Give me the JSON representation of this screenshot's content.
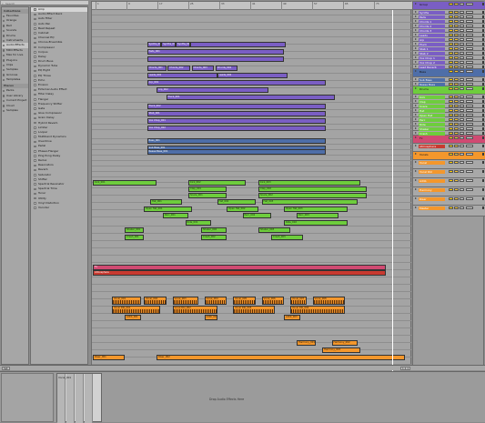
{
  "browser": {
    "search_placeholder": "Search",
    "collections_header": "Collections",
    "categories": [
      "Favorites",
      "Orange",
      "Red",
      "Sounds",
      "Drums",
      "Instruments",
      "Audio Effects",
      "MIDI Effects",
      "Max for Live",
      "Plug-Ins",
      "Clips",
      "Samples",
      "Grooves",
      "Templates"
    ],
    "selected_category": "Audio Effects",
    "places_header": "Places",
    "places": [
      "Packs",
      "User Library",
      "Current Project",
      "Cloud",
      "Samples"
    ],
    "items": [
      "Amp",
      "Audio Effect Rack",
      "Auto Filter",
      "Auto Pan",
      "Beat Repeat",
      "Cabinet",
      "Channel EQ",
      "Chorus-Ensemble",
      "Compressor",
      "Corpus",
      "Delay",
      "Drum Buss",
      "Dynamic Tube",
      "EQ Eight",
      "EQ Three",
      "Echo",
      "Erosion",
      "External Audio Effect",
      "Filter Delay",
      "Flanger",
      "Frequency Shifter",
      "Gate",
      "Glue Compressor",
      "Grain Delay",
      "Hybrid Reverb",
      "Limiter",
      "Looper",
      "Multiband Dynamics",
      "Overdrive",
      "Pedal",
      "Phaser-Flanger",
      "Ping Pong Delay",
      "Redux",
      "Resonators",
      "Reverb",
      "Saturator",
      "Shifter",
      "Spectral Resonator",
      "Spectral Time",
      "Tuner",
      "Utility",
      "Vinyl Distortion",
      "Vocoder"
    ],
    "selected_item": "Amp"
  },
  "arrangement": {
    "ruler_labels": [
      "1",
      "9",
      "17",
      "25",
      "33",
      "41",
      "49",
      "57",
      "65",
      "73"
    ],
    "clips": [
      {
        "row": 0,
        "start": 0.17,
        "len": 0.045,
        "color": "purple",
        "label": "Synths_001"
      },
      {
        "row": 0,
        "start": 0.215,
        "len": 0.045,
        "color": "purple",
        "label": "Synths_002"
      },
      {
        "row": 0,
        "start": 0.26,
        "len": 0.045,
        "color": "purple",
        "label": "Synths_003"
      },
      {
        "row": 0,
        "start": 0.305,
        "len": 0.3,
        "color": "purple",
        "label": ""
      },
      {
        "row": 1,
        "start": 0.17,
        "len": 0.43,
        "color": "purple",
        "label": "Pads_001"
      },
      {
        "row": 2,
        "start": 0.17,
        "len": 0.43,
        "color": "purple",
        "label": ""
      },
      {
        "row": 3,
        "start": 0.17,
        "len": 0.06,
        "color": "purple",
        "label": "Chords_001"
      },
      {
        "row": 3,
        "start": 0.235,
        "len": 0.07,
        "color": "purple",
        "label": "Chords_002"
      },
      {
        "row": 3,
        "start": 0.31,
        "len": 0.07,
        "color": "purple",
        "label": "Chords_003"
      },
      {
        "row": 3,
        "start": 0.385,
        "len": 0.07,
        "color": "purple",
        "label": "Chords_004"
      },
      {
        "row": 4,
        "start": 0.17,
        "len": 0.22,
        "color": "purple",
        "label": "Leads_001"
      },
      {
        "row": 4,
        "start": 0.39,
        "len": 0.22,
        "color": "purple",
        "label": "Leads_002"
      },
      {
        "row": 5,
        "start": 0.17,
        "len": 0.56,
        "color": "purple",
        "label": "Arp_001"
      },
      {
        "row": 6,
        "start": 0.2,
        "len": 0.35,
        "color": "purple",
        "label": "Arp_002"
      },
      {
        "row": 7,
        "start": 0.23,
        "len": 0.53,
        "color": "purple",
        "label": "Pluck_001"
      },
      {
        "row": 8,
        "start": 0.17,
        "len": 0.56,
        "color": "purple",
        "label": "Pluck_002"
      },
      {
        "row": 9,
        "start": 0.17,
        "len": 0.56,
        "color": "purple",
        "label": "Stab_001"
      },
      {
        "row": 10,
        "start": 0.17,
        "len": 0.56,
        "color": "purple",
        "label": "Vox Chop_001"
      },
      {
        "row": 11,
        "start": 0.17,
        "len": 0.56,
        "color": "purple",
        "label": "Vox Chop_002"
      },
      {
        "row": 12,
        "start": 0.17,
        "len": 0.56,
        "color": "blue",
        "label": "Bass_001"
      },
      {
        "row": 13,
        "start": 0.17,
        "len": 0.56,
        "color": "blue",
        "label": "Sub Bass_001"
      },
      {
        "row": 14,
        "start": 0.17,
        "len": 0.56,
        "color": "blue",
        "label": "Reese Bass_001"
      },
      {
        "row": 15,
        "start": 0,
        "len": 0.2,
        "color": "green",
        "label": "Kick_001"
      },
      {
        "row": 15,
        "start": 0.3,
        "len": 0.18,
        "color": "green",
        "label": "Kick_002"
      },
      {
        "row": 15,
        "start": 0.52,
        "len": 0.32,
        "color": "green",
        "label": "Kick_003"
      },
      {
        "row": 16,
        "start": 0.3,
        "len": 0.12,
        "color": "green",
        "label": "Clap_001"
      },
      {
        "row": 16,
        "start": 0.52,
        "len": 0.34,
        "color": "green",
        "label": "Clap_002"
      },
      {
        "row": 17,
        "start": 0.3,
        "len": 0.12,
        "color": "green",
        "label": "Snare_001"
      },
      {
        "row": 17,
        "start": 0.52,
        "len": 0.34,
        "color": "green",
        "label": "Snare_002"
      },
      {
        "row": 18,
        "start": 0.18,
        "len": 0.1,
        "color": "green",
        "label": "Hat_001"
      },
      {
        "row": 18,
        "start": 0.39,
        "len": 0.12,
        "color": "green",
        "label": "Hat_002"
      },
      {
        "row": 18,
        "start": 0.53,
        "len": 0.3,
        "color": "green",
        "label": "Hat_003"
      },
      {
        "row": 19,
        "start": 0.16,
        "len": 0.15,
        "color": "green",
        "label": "Open Hat_001"
      },
      {
        "row": 19,
        "start": 0.42,
        "len": 0.1,
        "color": "green",
        "label": "Open Hat_002"
      },
      {
        "row": 19,
        "start": 0.6,
        "len": 0.2,
        "color": "green",
        "label": "Open Hat_003"
      },
      {
        "row": 20,
        "start": 0.22,
        "len": 0.08,
        "color": "green",
        "label": "Perc_001"
      },
      {
        "row": 20,
        "start": 0.47,
        "len": 0.09,
        "color": "green",
        "label": "Perc_002"
      },
      {
        "row": 20,
        "start": 0.64,
        "len": 0.13,
        "color": "green",
        "label": "Perc_003"
      },
      {
        "row": 21,
        "start": 0.29,
        "len": 0.08,
        "color": "green",
        "label": "Ride_001"
      },
      {
        "row": 21,
        "start": 0.6,
        "len": 0.2,
        "color": "green",
        "label": "Ride_002"
      },
      {
        "row": 22,
        "start": 0.1,
        "len": 0.06,
        "color": "green",
        "label": "Shaker_001"
      },
      {
        "row": 22,
        "start": 0.34,
        "len": 0.08,
        "color": "green",
        "label": "Shaker_002"
      },
      {
        "row": 22,
        "start": 0.52,
        "len": 0.1,
        "color": "green",
        "label": "Shaker_003"
      },
      {
        "row": 23,
        "start": 0.1,
        "len": 0.06,
        "color": "green",
        "label": "Crash_001"
      },
      {
        "row": 23,
        "start": 0.34,
        "len": 0.08,
        "color": "green",
        "label": "Crash_002"
      },
      {
        "row": 23,
        "start": 0.56,
        "len": 0.1,
        "color": "green",
        "label": "Crash_003"
      },
      {
        "row": 24,
        "start": 0,
        "len": 0.92,
        "color": "pink",
        "label": "Fx"
      },
      {
        "row": 25,
        "start": 0,
        "len": 0.92,
        "color": "red",
        "label": "Atmosphere"
      },
      {
        "row": 26,
        "start": 0.06,
        "len": 0.09,
        "color": "orange",
        "label": "Vocal_001"
      },
      {
        "row": 26,
        "start": 0.16,
        "len": 0.07,
        "color": "orange",
        "label": "Vocal_002"
      },
      {
        "row": 26,
        "start": 0.25,
        "len": 0.08,
        "color": "orange",
        "label": "Vocal_003"
      },
      {
        "row": 26,
        "start": 0.35,
        "len": 0.07,
        "color": "orange",
        "label": "Vocal_004"
      },
      {
        "row": 26,
        "start": 0.44,
        "len": 0.07,
        "color": "orange",
        "label": "Vocal_005"
      },
      {
        "row": 26,
        "start": 0.53,
        "len": 0.07,
        "color": "orange",
        "label": "Vocal_006"
      },
      {
        "row": 26,
        "start": 0.62,
        "len": 0.05,
        "color": "orange",
        "label": "Vocal_007"
      },
      {
        "row": 26,
        "start": 0.69,
        "len": 0.1,
        "color": "orange",
        "label": "Vocal_008"
      },
      {
        "row": 27,
        "start": 0.06,
        "len": 0.15,
        "color": "orange",
        "label": "Vocal Dbl_001"
      },
      {
        "row": 27,
        "start": 0.25,
        "len": 0.14,
        "color": "orange",
        "label": "Vocal Dbl_002"
      },
      {
        "row": 27,
        "start": 0.44,
        "len": 0.13,
        "color": "orange",
        "label": "Vocal Dbl_003"
      },
      {
        "row": 27,
        "start": 0.62,
        "len": 0.17,
        "color": "orange",
        "label": "Vocal Dbl_004"
      },
      {
        "row": 28,
        "start": 0.1,
        "len": 0.05,
        "color": "orange",
        "label": "Adlib_001"
      },
      {
        "row": 28,
        "start": 0.35,
        "len": 0.04,
        "color": "orange",
        "label": "Adlib_002"
      },
      {
        "row": 28,
        "start": 0.6,
        "len": 0.05,
        "color": "orange",
        "label": "Adlib_003"
      },
      {
        "row": 29,
        "start": 0.64,
        "len": 0.06,
        "color": "orange",
        "label": "Harmony_001"
      },
      {
        "row": 29,
        "start": 0.75,
        "len": 0.08,
        "color": "orange",
        "label": "Harmony_002"
      },
      {
        "row": 30,
        "start": 0.72,
        "len": 0.12,
        "color": "orange",
        "label": "Harmony_003"
      },
      {
        "row": 31,
        "start": 0,
        "len": 0.1,
        "color": "orange",
        "label": "Riser_001"
      },
      {
        "row": 31,
        "start": 0.2,
        "len": 0.78,
        "color": "orange",
        "label": "Riser_002"
      }
    ]
  },
  "mixer": {
    "tracks": [
      {
        "name": "Group",
        "color": "#7a5ec4",
        "group": true
      },
      {
        "name": "Synths",
        "color": "#7a5ec4"
      },
      {
        "name": "Pads",
        "color": "#7a5ec4"
      },
      {
        "name": "Chords 1",
        "color": "#7a5ec4"
      },
      {
        "name": "Chords 2",
        "color": "#7a5ec4"
      },
      {
        "name": "Chords 3",
        "color": "#7a5ec4"
      },
      {
        "name": "Leads",
        "color": "#7a5ec4"
      },
      {
        "name": "Arp",
        "color": "#7a5ec4"
      },
      {
        "name": "Pluck",
        "color": "#7a5ec4"
      },
      {
        "name": "Stab 1",
        "color": "#7a5ec4"
      },
      {
        "name": "Stab 2",
        "color": "#7a5ec4"
      },
      {
        "name": "Vox Chop 1",
        "color": "#7a5ec4"
      },
      {
        "name": "Vox Chop 2",
        "color": "#7a5ec4"
      },
      {
        "name": "Lead Reverb",
        "color": "#7a5ec4"
      },
      {
        "name": "Bass",
        "color": "#4e6ea8",
        "group": true
      },
      {
        "name": "Sub Bass",
        "color": "#4e6ea8"
      },
      {
        "name": "Reese Bass",
        "color": "#4e6ea8"
      },
      {
        "name": "Drums",
        "color": "#6ecd3d",
        "group": true
      },
      {
        "name": "Kick",
        "color": "#6ecd3d"
      },
      {
        "name": "Clap",
        "color": "#6ecd3d"
      },
      {
        "name": "Snare",
        "color": "#6ecd3d"
      },
      {
        "name": "Hat",
        "color": "#6ecd3d"
      },
      {
        "name": "Open Hat",
        "color": "#6ecd3d"
      },
      {
        "name": "Perc",
        "color": "#6ecd3d"
      },
      {
        "name": "Ride",
        "color": "#6ecd3d"
      },
      {
        "name": "Shaker",
        "color": "#6ecd3d"
      },
      {
        "name": "Crash",
        "color": "#6ecd3d"
      },
      {
        "name": "Fx",
        "color": "#d04a72",
        "group": true
      },
      {
        "name": "Atmosphere",
        "color": "#c83a30"
      },
      {
        "name": "Vocals",
        "color": "#f4972c",
        "group": true
      },
      {
        "name": "Vocal",
        "color": "#f4972c"
      },
      {
        "name": "Vocal Dbl",
        "color": "#f4972c"
      },
      {
        "name": "Adlib",
        "color": "#f4972c"
      },
      {
        "name": "Harmony",
        "color": "#f4972c"
      },
      {
        "name": "Riser",
        "color": "#f4972c"
      },
      {
        "name": "Master",
        "color": "#f4972c"
      }
    ]
  },
  "detail": {
    "message": "Drop Audio Effects Here",
    "clip_name": "Vocal_001"
  },
  "statusbar": {
    "left": "Set",
    "right": "1.1.1"
  }
}
